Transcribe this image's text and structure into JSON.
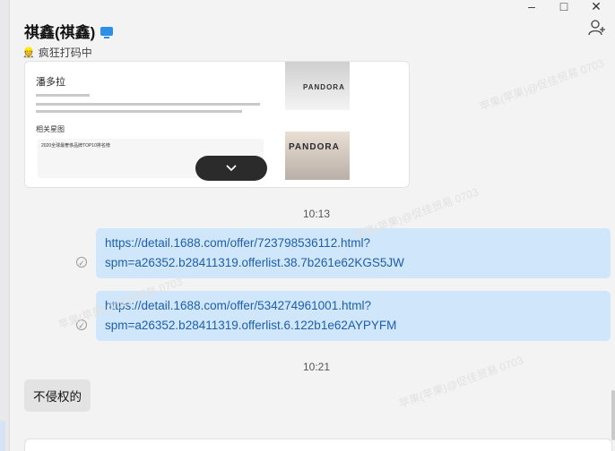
{
  "header": {
    "title": "祺鑫(祺鑫)",
    "status": "疯狂打码中",
    "window_controls": [
      "–",
      "□",
      "✕"
    ]
  },
  "image_message": {
    "heading": "潘多拉",
    "subheading": "相关星图",
    "card_text": "2020全球最奢侈品牌TOP10排名榜",
    "brand_top": "PANDORA",
    "brand_bottom": "PANDORA"
  },
  "messages": {
    "time1": "10:13",
    "link1_line1": "https://detail.1688.com/offer/723798536112.html?",
    "link1_line2": "spm=a26352.b28411319.offerlist.38.7b261e62KGS5JW",
    "link2_line1": "https://detail.1688.com/offer/534274961001.html?",
    "link2_line2": "spm=a26352.b28411319.offerlist.6.122b1e62AYPYFM",
    "time2": "10:21",
    "incoming_text": "不侵权的"
  },
  "watermark": "苹果(苹果)@促佳贸易 0703",
  "colors": {
    "outgoing_bubble": "#cfe6fb",
    "link_text": "#1f5fa8",
    "incoming_bubble": "#e3e3e3",
    "background": "#f3f3f3"
  },
  "icons": {
    "status": "user-status-icon",
    "add": "add-contact-icon",
    "expand": "chevron-down-icon",
    "read": "read-receipt-icon"
  }
}
